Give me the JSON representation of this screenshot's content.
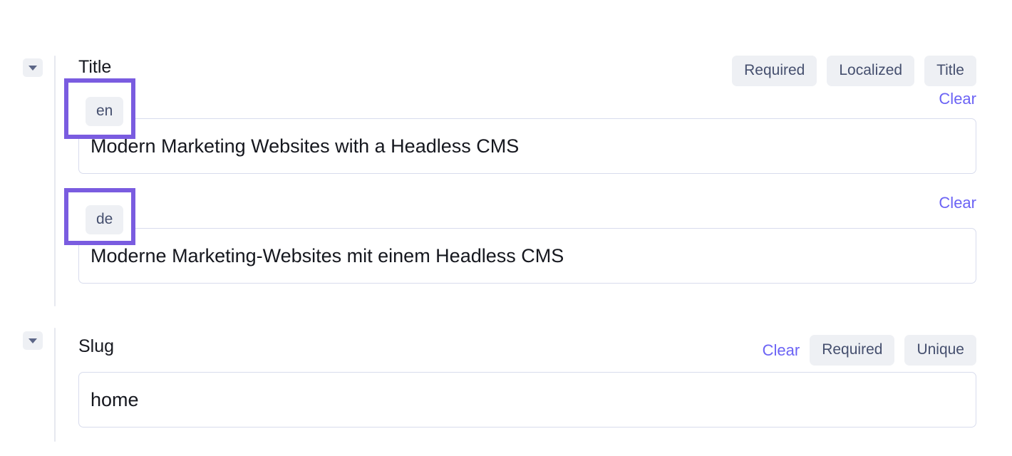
{
  "fields": [
    {
      "key": "title",
      "label": "Title",
      "collapse_icon": "chevron-down-icon",
      "meta_chips": [
        "Required",
        "Localized",
        "Title"
      ],
      "clear_label": "Clear",
      "locales": [
        {
          "code": "en",
          "clear_label": "Clear",
          "value": "Modern Marketing Websites with a Headless CMS",
          "placeholder": ""
        },
        {
          "code": "de",
          "clear_label": "Clear",
          "value": "Moderne Marketing-Websites mit einem Headless CMS",
          "placeholder": ""
        }
      ]
    },
    {
      "key": "slug",
      "label": "Slug",
      "collapse_icon": "chevron-down-icon",
      "clear_label": "Clear",
      "meta_chips": [
        "Required",
        "Unique"
      ],
      "value": "home",
      "placeholder": ""
    }
  ],
  "annotations": {
    "color": "#7a5ce0",
    "targets": [
      "locale-chip-en",
      "locale-chip-de"
    ]
  },
  "colors": {
    "accent_link": "#6b63f5",
    "chip_bg": "#eef0f4",
    "chip_text": "#454f6e",
    "input_border": "#d8dced",
    "text": "#16181f",
    "rule": "#e6e8ef",
    "annotation_purple": "#7a5ce0"
  }
}
